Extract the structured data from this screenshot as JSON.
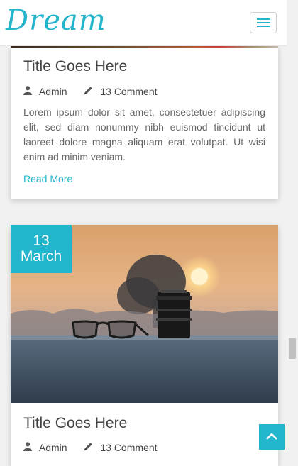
{
  "brand": {
    "logo_text": "Dream"
  },
  "posts": [
    {
      "title": "Title Goes Here",
      "author": "Admin",
      "comments": "13 Comment",
      "excerpt": "Lorem ipsum dolor sit amet, consectetuer adipiscing elit, sed diam nonummy nibh euismod tincidunt ut laoreet dolore magna aliquam erat volutpat. Ut wisi enim ad minim veniam.",
      "read_more": "Read More"
    },
    {
      "date_day": "13",
      "date_month": "March",
      "title": "Title Goes Here",
      "author": "Admin",
      "comments": "13 Comment"
    }
  ],
  "colors": {
    "accent": "#22b5cc",
    "page_bg": "#f1f1f1"
  },
  "icons": {
    "menu": "hamburger-icon",
    "author": "user-icon",
    "comments": "pencil-icon",
    "back_to_top": "chevron-up-icon"
  }
}
